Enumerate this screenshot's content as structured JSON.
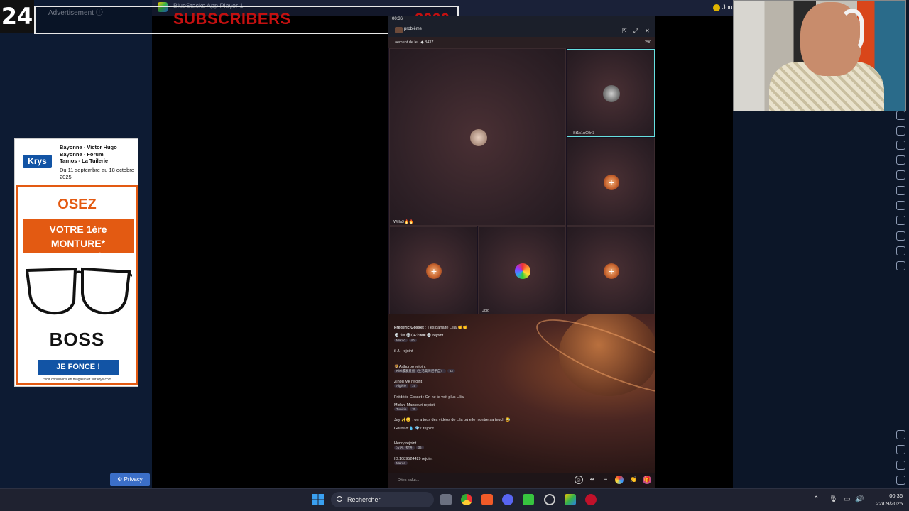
{
  "overlay": {
    "channel_number": "24",
    "ad_label": "Advertisement ⓘ",
    "subs_label": "SUBSCRIBERS",
    "subs_count": "2000",
    "bluestacks_title": "BlueStacks App Player 1",
    "top_right_label": "Jou"
  },
  "ad": {
    "brand": "Krys",
    "locations": [
      "Bayonne - Victor Hugo",
      "Bayonne - Forum",
      "Tarnos - La Tuilerie"
    ],
    "dates": "Du 11 septembre au 18 octobre 2025",
    "headline": "OSEZ",
    "banner_line1": "VOTRE 1ère MONTURE*",
    "banner_line2": "DE CARACTÈRE",
    "product": "BOSS",
    "cta": "JE FONCE !",
    "footnote": "*Voir conditions en magasin et sur krys.com",
    "privacy": "Privacy"
  },
  "game": {
    "time": "00:36",
    "room_name": "problème",
    "info_left": "aement de le",
    "info_count": "8437",
    "viewers": "290",
    "tile_names": {
      "host": "Willa3🔥🔥",
      "selected": "St1s1nC0n3",
      "bottom_mid": "Jojo"
    },
    "chat": [
      {
        "name": "Frédéric Gosset",
        "text": ": T'es parfaite Lilia 👏👏"
      },
      {
        "name": "💀 ℛ𝔞 💀ℂ₭ℛ₳₩ 💀",
        "text": "rejoint",
        "tag": "Maroc",
        "badge": "40"
      },
      {
        "name": "iI J..",
        "text": "rejoint"
      },
      {
        "name": "🦁Arthuroo",
        "text": "rejoint",
        "tag": "Kiwi最爱爱盘（生活美味记乎自）",
        "badge": "63"
      },
      {
        "name": "Zinou Mk",
        "text": "rejoint",
        "tag": "Algérie",
        "badge": "19"
      },
      {
        "name": "Frédéric Gosset",
        "text": ": On ne te voit plus Lilia"
      },
      {
        "name": "Midani Mansouri",
        "text": "rejoint",
        "tag": "Tunisie",
        "badge": "35"
      },
      {
        "name": "Jay ✨😊",
        "text": ": on a tous des vidéos de Lila où elle montre sa teuch 😂"
      },
      {
        "name": "Goûte d'💧 💎Z",
        "text": "rejoint"
      },
      {
        "name": "Henry",
        "text": "rejoint",
        "tag": "法语、捷语",
        "badge": "36"
      },
      {
        "name": "ID:1089524429",
        "text": "rejoint",
        "tag": "Maroc"
      }
    ],
    "input_placeholder": "Dites salut..."
  },
  "taskbar": {
    "search_label": "Rechercher",
    "time": "00:36",
    "date": "22/09/2025"
  },
  "colors": {
    "subs_red": "#c41010",
    "krys_blue": "#1254a5",
    "krys_orange": "#e35a12",
    "selected_tile": "#66e0e0"
  }
}
